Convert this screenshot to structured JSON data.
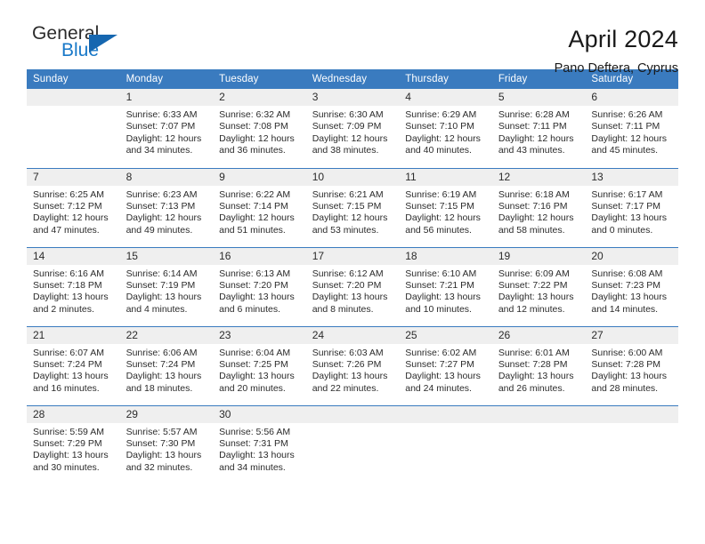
{
  "brand": {
    "name_top": "General",
    "name_bottom": "Blue",
    "accent_color": "#1878c8",
    "triangle_color": "#1667b0"
  },
  "header": {
    "title": "April 2024",
    "subtitle": "Pano Deftera, Cyprus",
    "header_bg": "#3a7bbf",
    "daynum_bg": "#efefef"
  },
  "weekday_headers": [
    "Sunday",
    "Monday",
    "Tuesday",
    "Wednesday",
    "Thursday",
    "Friday",
    "Saturday"
  ],
  "labels": {
    "sunrise": "Sunrise:",
    "sunset": "Sunset:",
    "daylight": "Daylight:"
  },
  "weeks": [
    [
      {
        "day": "",
        "blank": true,
        "sunrise": "",
        "sunset": "",
        "daylight_1": "",
        "daylight_2": ""
      },
      {
        "day": "1",
        "blank": false,
        "sunrise": "Sunrise: 6:33 AM",
        "sunset": "Sunset: 7:07 PM",
        "daylight_1": "Daylight: 12 hours",
        "daylight_2": "and 34 minutes."
      },
      {
        "day": "2",
        "blank": false,
        "sunrise": "Sunrise: 6:32 AM",
        "sunset": "Sunset: 7:08 PM",
        "daylight_1": "Daylight: 12 hours",
        "daylight_2": "and 36 minutes."
      },
      {
        "day": "3",
        "blank": false,
        "sunrise": "Sunrise: 6:30 AM",
        "sunset": "Sunset: 7:09 PM",
        "daylight_1": "Daylight: 12 hours",
        "daylight_2": "and 38 minutes."
      },
      {
        "day": "4",
        "blank": false,
        "sunrise": "Sunrise: 6:29 AM",
        "sunset": "Sunset: 7:10 PM",
        "daylight_1": "Daylight: 12 hours",
        "daylight_2": "and 40 minutes."
      },
      {
        "day": "5",
        "blank": false,
        "sunrise": "Sunrise: 6:28 AM",
        "sunset": "Sunset: 7:11 PM",
        "daylight_1": "Daylight: 12 hours",
        "daylight_2": "and 43 minutes."
      },
      {
        "day": "6",
        "blank": false,
        "sunrise": "Sunrise: 6:26 AM",
        "sunset": "Sunset: 7:11 PM",
        "daylight_1": "Daylight: 12 hours",
        "daylight_2": "and 45 minutes."
      }
    ],
    [
      {
        "day": "7",
        "blank": false,
        "sunrise": "Sunrise: 6:25 AM",
        "sunset": "Sunset: 7:12 PM",
        "daylight_1": "Daylight: 12 hours",
        "daylight_2": "and 47 minutes."
      },
      {
        "day": "8",
        "blank": false,
        "sunrise": "Sunrise: 6:23 AM",
        "sunset": "Sunset: 7:13 PM",
        "daylight_1": "Daylight: 12 hours",
        "daylight_2": "and 49 minutes."
      },
      {
        "day": "9",
        "blank": false,
        "sunrise": "Sunrise: 6:22 AM",
        "sunset": "Sunset: 7:14 PM",
        "daylight_1": "Daylight: 12 hours",
        "daylight_2": "and 51 minutes."
      },
      {
        "day": "10",
        "blank": false,
        "sunrise": "Sunrise: 6:21 AM",
        "sunset": "Sunset: 7:15 PM",
        "daylight_1": "Daylight: 12 hours",
        "daylight_2": "and 53 minutes."
      },
      {
        "day": "11",
        "blank": false,
        "sunrise": "Sunrise: 6:19 AM",
        "sunset": "Sunset: 7:15 PM",
        "daylight_1": "Daylight: 12 hours",
        "daylight_2": "and 56 minutes."
      },
      {
        "day": "12",
        "blank": false,
        "sunrise": "Sunrise: 6:18 AM",
        "sunset": "Sunset: 7:16 PM",
        "daylight_1": "Daylight: 12 hours",
        "daylight_2": "and 58 minutes."
      },
      {
        "day": "13",
        "blank": false,
        "sunrise": "Sunrise: 6:17 AM",
        "sunset": "Sunset: 7:17 PM",
        "daylight_1": "Daylight: 13 hours",
        "daylight_2": "and 0 minutes."
      }
    ],
    [
      {
        "day": "14",
        "blank": false,
        "sunrise": "Sunrise: 6:16 AM",
        "sunset": "Sunset: 7:18 PM",
        "daylight_1": "Daylight: 13 hours",
        "daylight_2": "and 2 minutes."
      },
      {
        "day": "15",
        "blank": false,
        "sunrise": "Sunrise: 6:14 AM",
        "sunset": "Sunset: 7:19 PM",
        "daylight_1": "Daylight: 13 hours",
        "daylight_2": "and 4 minutes."
      },
      {
        "day": "16",
        "blank": false,
        "sunrise": "Sunrise: 6:13 AM",
        "sunset": "Sunset: 7:20 PM",
        "daylight_1": "Daylight: 13 hours",
        "daylight_2": "and 6 minutes."
      },
      {
        "day": "17",
        "blank": false,
        "sunrise": "Sunrise: 6:12 AM",
        "sunset": "Sunset: 7:20 PM",
        "daylight_1": "Daylight: 13 hours",
        "daylight_2": "and 8 minutes."
      },
      {
        "day": "18",
        "blank": false,
        "sunrise": "Sunrise: 6:10 AM",
        "sunset": "Sunset: 7:21 PM",
        "daylight_1": "Daylight: 13 hours",
        "daylight_2": "and 10 minutes."
      },
      {
        "day": "19",
        "blank": false,
        "sunrise": "Sunrise: 6:09 AM",
        "sunset": "Sunset: 7:22 PM",
        "daylight_1": "Daylight: 13 hours",
        "daylight_2": "and 12 minutes."
      },
      {
        "day": "20",
        "blank": false,
        "sunrise": "Sunrise: 6:08 AM",
        "sunset": "Sunset: 7:23 PM",
        "daylight_1": "Daylight: 13 hours",
        "daylight_2": "and 14 minutes."
      }
    ],
    [
      {
        "day": "21",
        "blank": false,
        "sunrise": "Sunrise: 6:07 AM",
        "sunset": "Sunset: 7:24 PM",
        "daylight_1": "Daylight: 13 hours",
        "daylight_2": "and 16 minutes."
      },
      {
        "day": "22",
        "blank": false,
        "sunrise": "Sunrise: 6:06 AM",
        "sunset": "Sunset: 7:24 PM",
        "daylight_1": "Daylight: 13 hours",
        "daylight_2": "and 18 minutes."
      },
      {
        "day": "23",
        "blank": false,
        "sunrise": "Sunrise: 6:04 AM",
        "sunset": "Sunset: 7:25 PM",
        "daylight_1": "Daylight: 13 hours",
        "daylight_2": "and 20 minutes."
      },
      {
        "day": "24",
        "blank": false,
        "sunrise": "Sunrise: 6:03 AM",
        "sunset": "Sunset: 7:26 PM",
        "daylight_1": "Daylight: 13 hours",
        "daylight_2": "and 22 minutes."
      },
      {
        "day": "25",
        "blank": false,
        "sunrise": "Sunrise: 6:02 AM",
        "sunset": "Sunset: 7:27 PM",
        "daylight_1": "Daylight: 13 hours",
        "daylight_2": "and 24 minutes."
      },
      {
        "day": "26",
        "blank": false,
        "sunrise": "Sunrise: 6:01 AM",
        "sunset": "Sunset: 7:28 PM",
        "daylight_1": "Daylight: 13 hours",
        "daylight_2": "and 26 minutes."
      },
      {
        "day": "27",
        "blank": false,
        "sunrise": "Sunrise: 6:00 AM",
        "sunset": "Sunset: 7:28 PM",
        "daylight_1": "Daylight: 13 hours",
        "daylight_2": "and 28 minutes."
      }
    ],
    [
      {
        "day": "28",
        "blank": false,
        "sunrise": "Sunrise: 5:59 AM",
        "sunset": "Sunset: 7:29 PM",
        "daylight_1": "Daylight: 13 hours",
        "daylight_2": "and 30 minutes."
      },
      {
        "day": "29",
        "blank": false,
        "sunrise": "Sunrise: 5:57 AM",
        "sunset": "Sunset: 7:30 PM",
        "daylight_1": "Daylight: 13 hours",
        "daylight_2": "and 32 minutes."
      },
      {
        "day": "30",
        "blank": false,
        "sunrise": "Sunrise: 5:56 AM",
        "sunset": "Sunset: 7:31 PM",
        "daylight_1": "Daylight: 13 hours",
        "daylight_2": "and 34 minutes."
      },
      {
        "day": "",
        "blank": true,
        "sunrise": "",
        "sunset": "",
        "daylight_1": "",
        "daylight_2": ""
      },
      {
        "day": "",
        "blank": true,
        "sunrise": "",
        "sunset": "",
        "daylight_1": "",
        "daylight_2": ""
      },
      {
        "day": "",
        "blank": true,
        "sunrise": "",
        "sunset": "",
        "daylight_1": "",
        "daylight_2": ""
      },
      {
        "day": "",
        "blank": true,
        "sunrise": "",
        "sunset": "",
        "daylight_1": "",
        "daylight_2": ""
      }
    ]
  ]
}
